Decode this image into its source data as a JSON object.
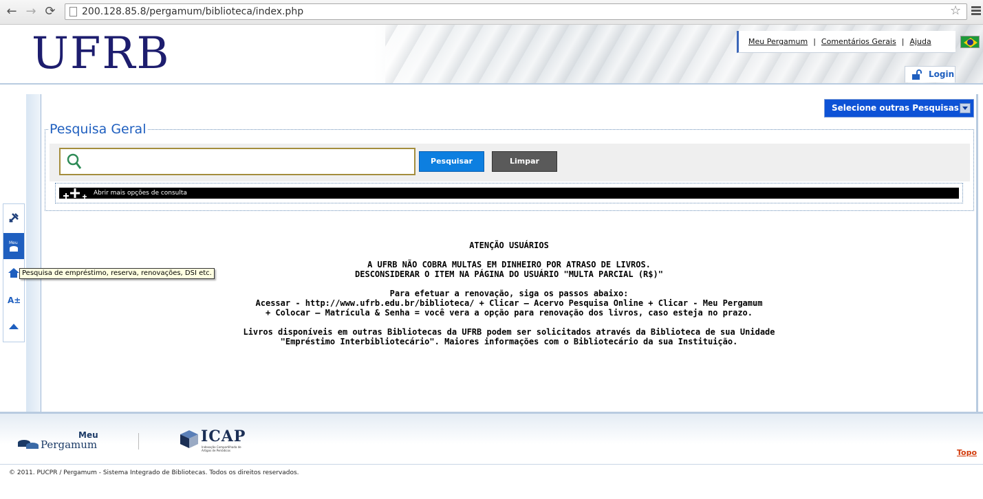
{
  "browser": {
    "url": "200.128.85.8/pergamum/biblioteca/index.php"
  },
  "header": {
    "logo_text": "UFRB",
    "links": [
      "Meu Pergamum",
      "Comentários Gerais",
      "Ajuda"
    ],
    "separator": "|",
    "login_label": "Login"
  },
  "search": {
    "other_searches_label": "Selecione outras Pesquisas",
    "legend": "Pesquisa Geral",
    "input_value": "",
    "search_button": "Pesquisar",
    "clear_button": "Limpar",
    "more_options": "Abrir mais opções de consulta"
  },
  "side_toolbar": {
    "meu_label": "Meu",
    "tooltip": "Pesquisa de empréstimo, reserva, renovações, DSI etc."
  },
  "notice": {
    "title": "ATENÇÃO USUÁRIOS",
    "line1": "A UFRB NÃO COBRA MULTAS EM DINHEIRO POR ATRASO DE LIVROS.",
    "line2": "DESCONSIDERAR O ITEM NA PÁGINA DO USUÁRIO \"MULTA PARCIAL (R$)\"",
    "line3": "Para efetuar a renovação, siga os passos abaixo:",
    "line4": "Acessar - http://www.ufrb.edu.br/biblioteca/ + Clicar – Acervo Pesquisa Online + Clicar - Meu Pergamum",
    "line5": "+ Colocar – Matrícula & Senha = você vera a opção para renovação dos livros, caso esteja no prazo.",
    "line6": "Livros disponíveis em outras Bibliotecas da UFRB podem ser solicitados através da Biblioteca de sua Unidade",
    "line7": "\"Empréstimo Interbibliotecário\". Maiores informações com o Bibliotecário da sua Instituição."
  },
  "footer": {
    "meu_label": "Meu",
    "pergamum_label": "Pergamum",
    "icap_label": "ICAP",
    "icap_sub": "Indexação Compartilhada de Artigos de Periódicos",
    "topo_label": "Topo",
    "copyright": "© 2011. PUCPR / Pergamum - Sistema Integrado de Bibliotecas. Todos os direitos reservados."
  },
  "colors": {
    "brand_blue": "#1f5fbf",
    "search_button": "#0d7fe0",
    "clear_button": "#5a5a5a",
    "topo": "#d23a0a"
  }
}
